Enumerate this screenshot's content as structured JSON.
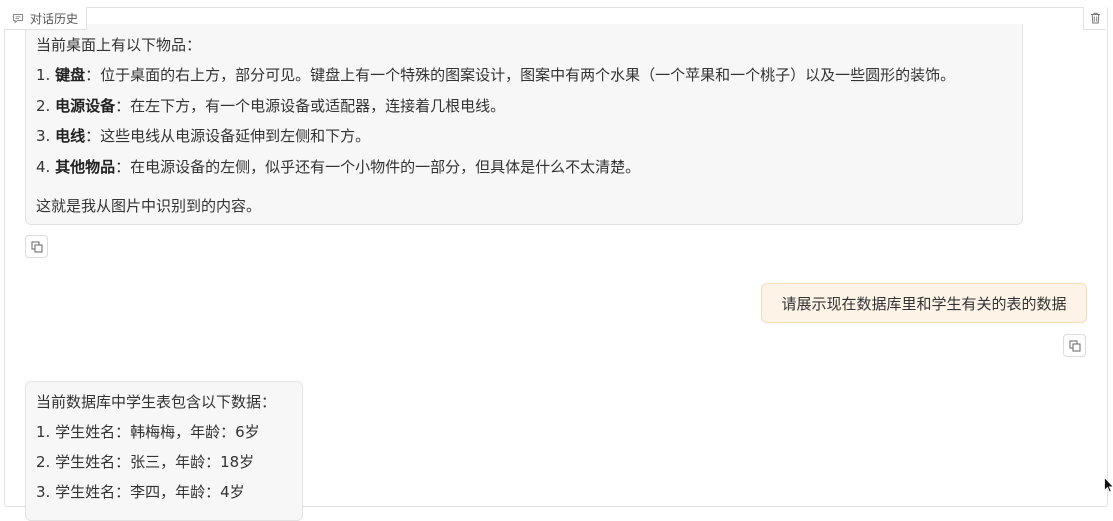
{
  "header": {
    "history_label": "对话历史",
    "history_icon": "chat-history-icon",
    "trash_icon": "trash-icon"
  },
  "messages": {
    "assistant_1": {
      "intro": "当前桌面上有以下物品：",
      "items": [
        {
          "prefix": "1. ",
          "name": "键盘",
          "desc": "：位于桌面的右上方，部分可见。键盘上有一个特殊的图案设计，图案中有两个水果（一个苹果和一个桃子）以及一些圆形的装饰。"
        },
        {
          "prefix": "2. ",
          "name": "电源设备",
          "desc": "：在左下方，有一个电源设备或适配器，连接着几根电线。"
        },
        {
          "prefix": "3. ",
          "name": "电线",
          "desc": "：这些电线从电源设备延伸到左侧和下方。"
        },
        {
          "prefix": "4. ",
          "name": "其他物品",
          "desc": "：在电源设备的左侧，似乎还有一个小物件的一部分，但具体是什么不太清楚。"
        }
      ],
      "outro": "这就是我从图片中识别到的内容。"
    },
    "user_1": {
      "text": "请展示现在数据库里和学生有关的表的数据"
    },
    "assistant_2": {
      "intro": "当前数据库中学生表包含以下数据：",
      "rows": [
        "1. 学生姓名：韩梅梅，年龄：6岁",
        "2. 学生姓名：张三，年龄：18岁",
        "3. 学生姓名：李四，年龄：4岁"
      ]
    }
  },
  "colors": {
    "assistant_bubble_bg": "#f7f7f7",
    "user_bubble_bg": "#fdf4e7",
    "user_bubble_border": "#f4dcb9",
    "border": "#e2e2e2"
  }
}
